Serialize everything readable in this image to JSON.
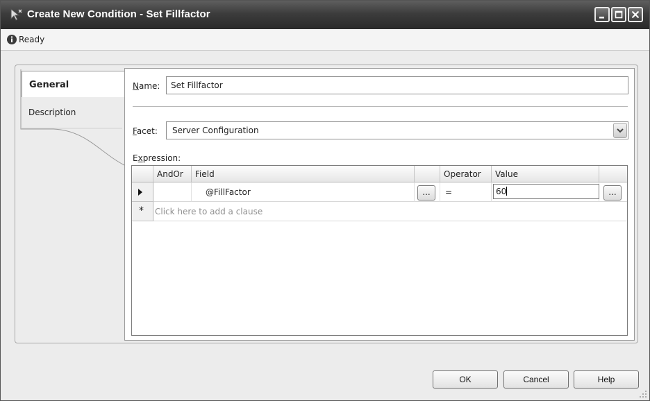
{
  "window": {
    "title": "Create New Condition - Set Fillfactor",
    "status": "Ready"
  },
  "pages": {
    "items": [
      {
        "label": "General",
        "selected": true
      },
      {
        "label": "Description",
        "selected": false
      }
    ]
  },
  "form": {
    "name_label_underline": "N",
    "name_label_rest": "ame:",
    "name_value": "Set Fillfactor",
    "facet_label_underline": "F",
    "facet_label_rest": "acet:",
    "facet_value": "Server Configuration",
    "expression_label_pre": "E",
    "expression_label_underline": "x",
    "expression_label_rest": "pression:"
  },
  "grid": {
    "columns": [
      "AndOr",
      "Field",
      "",
      "Operator",
      "Value",
      ""
    ],
    "rows": [
      {
        "andor": "",
        "field": "@FillFactor",
        "operator": "=",
        "value": "60"
      }
    ],
    "add_clause": "Click here to add a clause",
    "ellipsis": "...",
    "new_row_marker": "*"
  },
  "buttons": {
    "ok": "OK",
    "cancel": "Cancel",
    "help": "Help"
  },
  "icons": {
    "app": "condition-wizard-icon",
    "info": "info-icon",
    "combo": "chevron-down-icon",
    "row_current": "row-pointer-icon"
  }
}
